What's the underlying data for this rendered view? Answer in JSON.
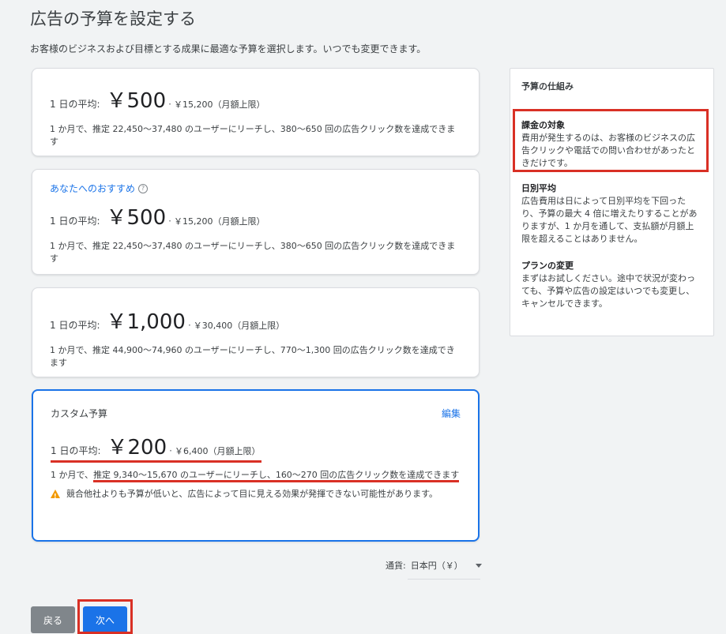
{
  "header": {
    "title": "広告の予算を設定する",
    "subtitle": "お客様のビジネスおよび目標とする成果に最適な予算を選択します。いつでも変更できます。"
  },
  "options": [
    {
      "label": "1 日の平均:",
      "amount": "￥500",
      "monthly": "￥15,200（月額上限）",
      "reach": "1 か月で、推定 22,450〜37,480 のユーザーにリーチし、380〜650 回の広告クリック数を達成できます"
    },
    {
      "recommend": "あなたへのおすすめ",
      "label": "1 日の平均:",
      "amount": "￥500",
      "monthly": "￥15,200（月額上限）",
      "reach": "1 か月で、推定 22,450〜37,480 のユーザーにリーチし、380〜650 回の広告クリック数を達成できます"
    },
    {
      "label": "1 日の平均:",
      "amount": "￥1,000",
      "monthly": "￥30,400（月額上限）",
      "reach": "1 か月で、推定 44,900〜74,960 のユーザーにリーチし、770〜1,300 回の広告クリック数を達成できます"
    }
  ],
  "custom": {
    "title": "カスタム予算",
    "edit": "編集",
    "label": "1 日の平均:",
    "amount": "￥200",
    "monthly": "￥6,400（月額上限）",
    "reach_prefix": "1 か月で、",
    "reach_highlight": "推定 9,340〜15,670 のユーザーにリーチし、160〜270 回の広告クリック数を達成できます",
    "warning": "競合他社よりも予算が低いと、広告によって目に見える効果が発揮できない可能性があります。"
  },
  "info": {
    "title": "予算の仕組み",
    "sections": [
      {
        "heading": "課金の対象",
        "body": "費用が発生するのは、お客様のビジネスの広告クリックや電話での問い合わせがあったときだけです。"
      },
      {
        "heading": "日別平均",
        "body": "広告費用は日によって日別平均を下回ったり、予算の最大 4 倍に増えたりすることがありますが、1 か月を通して、支払額が月額上限を超えることはありません。"
      },
      {
        "heading": "プランの変更",
        "body": "まずはお試しください。途中で状況が変わっても、予算や広告の設定はいつでも変更し、キャンセルできます。"
      }
    ]
  },
  "currency": {
    "label": "通貨:",
    "value": "日本円（￥）"
  },
  "buttons": {
    "back": "戻る",
    "next": "次へ"
  },
  "colors": {
    "accent": "#1a73e8",
    "highlight": "#d93025",
    "warning": "#f29900"
  }
}
